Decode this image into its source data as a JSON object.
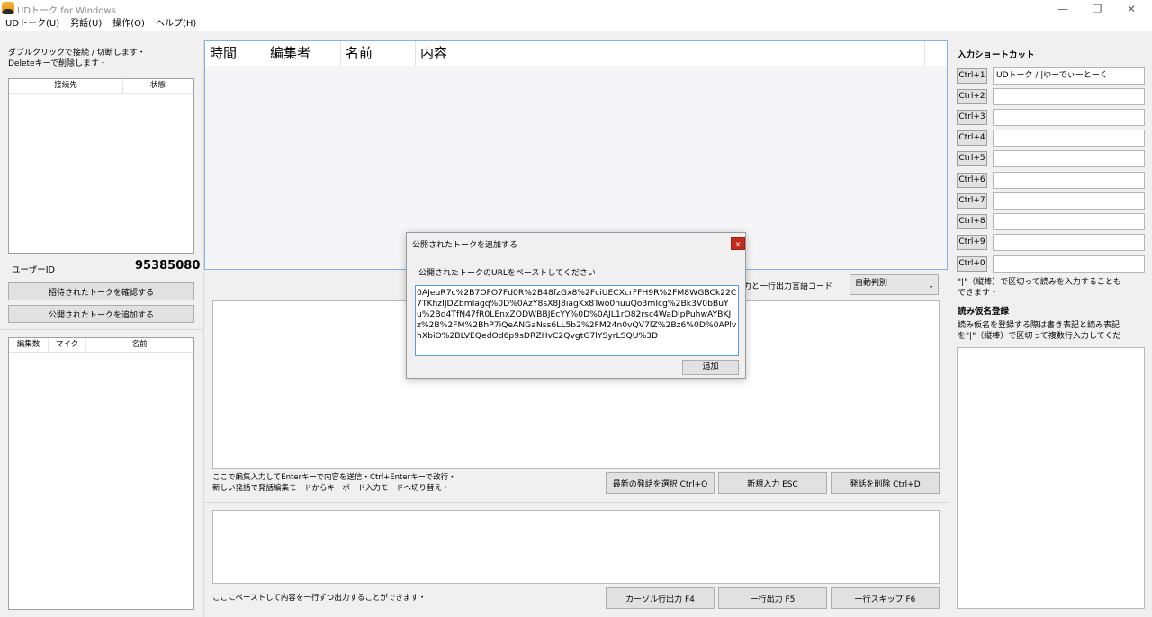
{
  "window": {
    "title": "UDトーク for Windows",
    "minimize_glyph": "—",
    "restore_glyph": "❐",
    "close_glyph": "✕"
  },
  "menu": [
    "UDトーク(U)",
    "発話(U)",
    "操作(O)",
    "ヘルプ(H)"
  ],
  "left": {
    "instruction_line1": "ダブルクリックで接続 / 切断します・",
    "instruction_line2": "Deleteキーで削除します・",
    "connections_columns": [
      "接続先",
      "状態"
    ],
    "user_id_label": "ユーザーID",
    "user_id_value": "95385080",
    "invited_button": "招待されたトークを確認する",
    "add_public_button": "公開されたトークを追加する",
    "participants_columns": [
      "編集数",
      "マイク",
      "名前"
    ]
  },
  "center": {
    "list_columns": [
      "時間",
      "編集者",
      "名前",
      "内容"
    ],
    "lang_label": "力と一行出力言語コード",
    "lang_select": "自動判別",
    "edit_hint_line1": "ここで編集入力してEnterキーで内容を送信・Ctrl+Enterキーで改行・",
    "edit_hint_line2": "新しい発話で発話編集モードからキーボード入力モードへ切り替え・",
    "btn_select_latest": "最新の発話を選択 Ctrl+O",
    "btn_new_input": "新規入力 ESC",
    "btn_delete": "発話を削除 Ctrl+D",
    "paste_hint": "ここにペーストして内容を一行ずつ出力することができます・",
    "btn_cursor_out": "カーソル行出力 F4",
    "btn_line_out": "一行出力 F5",
    "btn_line_skip": "一行スキップ F6"
  },
  "right": {
    "shortcut_title": "入力ショートカット",
    "shortcuts": [
      {
        "key": "Ctrl+1",
        "value": "UDトーク / |ゆーでぃーとーく"
      },
      {
        "key": "Ctrl+2",
        "value": ""
      },
      {
        "key": "Ctrl+3",
        "value": ""
      },
      {
        "key": "Ctrl+4",
        "value": ""
      },
      {
        "key": "Ctrl+5",
        "value": ""
      },
      {
        "key": "Ctrl+6",
        "value": ""
      },
      {
        "key": "Ctrl+7",
        "value": ""
      },
      {
        "key": "Ctrl+8",
        "value": ""
      },
      {
        "key": "Ctrl+9",
        "value": ""
      },
      {
        "key": "Ctrl+0",
        "value": ""
      }
    ],
    "shortcut_note_line1": "\"|\"（縦棒）で区切って読みを入力することも",
    "shortcut_note_line2": "できます・",
    "kana_title": "読み仮名登録",
    "kana_note_line1": "読み仮名を登録する際は書き表記と読み表記",
    "kana_note_line2": "を\"|\"（縦棒）で区切って複数行入力してくだ"
  },
  "dialog": {
    "title": "公開されたトークを追加する",
    "close_glyph": "×",
    "prompt": "公開されたトークのURLをペーストしてください",
    "url_text": "0AJeuR7c%2B7OFO7Fd0R%2B48fzGx8%2FciUECXcrFFH9R%2FM8WGBCk22C7TKhzIJDZbmlagq%0D%0AzY8sX8J8iagKx8Two0nuuQo3mIcg%2Bk3V0bBuYu%2Bd4TfN47fR0LEnxZQDWBBJEcYY%0D%0AJL1rO82rsc4WaDlpPuhwAYBKJz%2B%2FM%2BhP7iQeANGaNss6LL5b2%2FM24n0vQV7lZ%2Bz6%0D%0APlvhXbiO%2BLVEQedOd6p9sDRZHvC2QvgtG7lYSyrLSQU%3D",
    "add_button": "追加"
  }
}
